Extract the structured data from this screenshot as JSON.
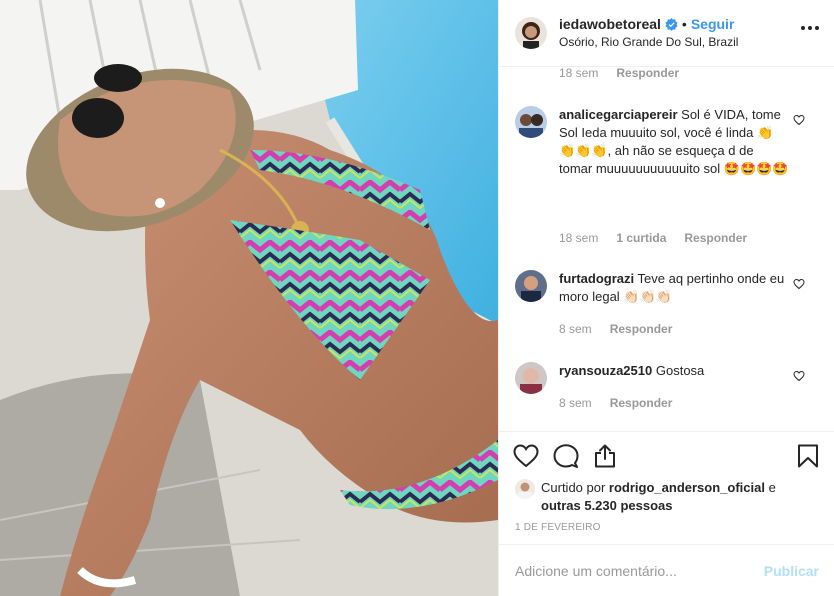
{
  "post": {
    "image_alt": "",
    "header": {
      "username": "iedawobetoreal",
      "separator": "•",
      "follow_label": "Seguir",
      "location": "Osório, Rio Grande Do Sul, Brazil"
    },
    "comments": [
      {
        "username": "",
        "text": "",
        "time": "18 sem",
        "reply_label": "Responder",
        "partial": true
      },
      {
        "username": "analicegarciapereir",
        "text": "Sol é VIDA, tome Sol Ieda muuuito sol, você é linda 👏👏👏👏, ah não se esqueça d de tomar muuuuuuuuuuuito sol 🤩🤩🤩🤩",
        "time": "18 sem",
        "likes": "1 curtida",
        "reply_label": "Responder"
      },
      {
        "username": "furtadograzi",
        "text": "Teve aq pertinho onde eu moro legal 👏🏻👏🏻👏🏻",
        "time": "8 sem",
        "reply_label": "Responder"
      },
      {
        "username": "ryansouza2510",
        "text": "Gostosa",
        "time": "8 sem",
        "reply_label": "Responder"
      }
    ],
    "likes_line": {
      "prefix": "Curtido por ",
      "user": "rodrigo_anderson_oficial",
      "middle": " e",
      "others": "outras 5.230 pessoas"
    },
    "date": "1 DE FEVEREIRO",
    "add_comment": {
      "placeholder": "Adicione um comentário...",
      "publish_label": "Publicar"
    },
    "icons": {
      "like": "heart-icon",
      "comment": "comment-bubble-icon",
      "share": "share-icon",
      "save": "bookmark-icon",
      "more": "more-options-icon",
      "verified": "verified-badge-icon",
      "comment_like": "small-heart-icon"
    },
    "colors": {
      "link_blue": "#3897f0",
      "publish_disabled": "#b2dffc",
      "muted": "#999999",
      "text": "#262626"
    }
  }
}
